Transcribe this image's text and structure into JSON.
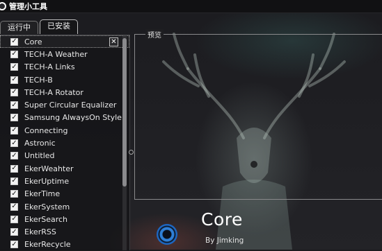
{
  "window": {
    "title": "管理小工具"
  },
  "tabs": [
    {
      "label": "运行中",
      "active": false
    },
    {
      "label": "已安装",
      "active": true
    }
  ],
  "widgets": [
    {
      "name": "Core",
      "checked": true,
      "selected": true
    },
    {
      "name": "TECH-A Weather",
      "checked": true
    },
    {
      "name": "TECH-A Links",
      "checked": true
    },
    {
      "name": "TECH-B",
      "checked": true
    },
    {
      "name": "TECH-A Rotator",
      "checked": true
    },
    {
      "name": "Super Circular Equalizer",
      "checked": true
    },
    {
      "name": "Samsung AlwaysOn Style",
      "checked": true
    },
    {
      "name": "Connecting",
      "checked": true
    },
    {
      "name": "Astronic",
      "checked": true
    },
    {
      "name": "Untitled",
      "checked": true
    },
    {
      "name": "EkerWeahter",
      "checked": true
    },
    {
      "name": "EkerUptime",
      "checked": true
    },
    {
      "name": "EkerTime",
      "checked": true
    },
    {
      "name": "EkerSystem",
      "checked": true
    },
    {
      "name": "EkerSearch",
      "checked": true
    },
    {
      "name": "EkerRSS",
      "checked": true
    },
    {
      "name": "EkerRecycle",
      "checked": true
    }
  ],
  "checkmark": "✓",
  "remove_symbol": "✕",
  "preview": {
    "legend": "预览",
    "widget_name": "Core",
    "author": "By Jimking"
  }
}
